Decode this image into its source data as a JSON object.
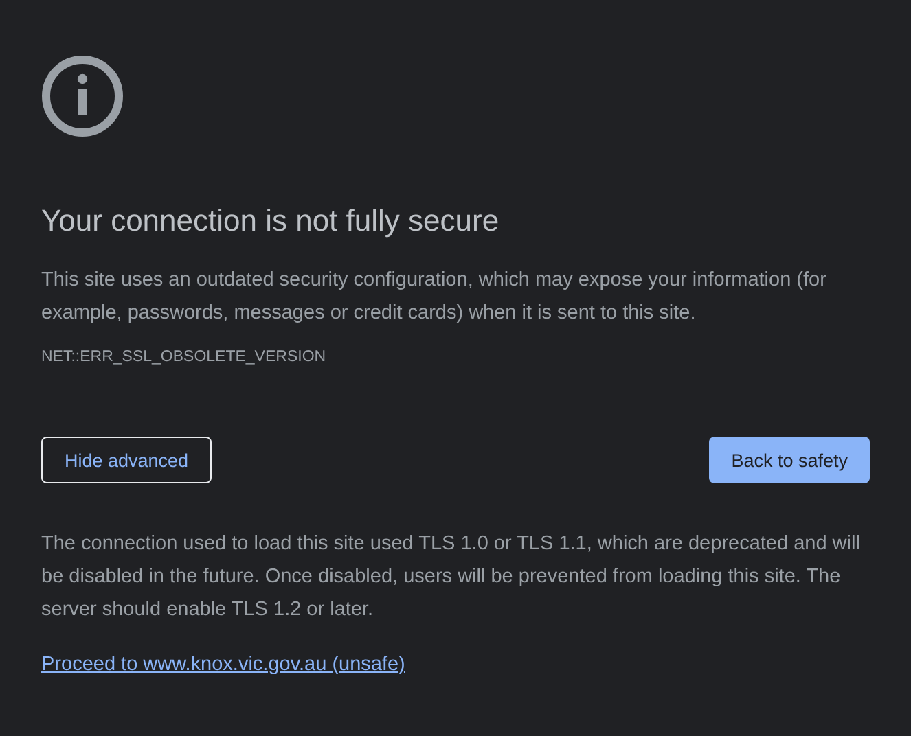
{
  "heading": "Your connection is not fully secure",
  "message": "This site uses an outdated security configuration, which may expose your information (for example, passwords, messages or credit cards) when it is sent to this site.",
  "error_code": "NET::ERR_SSL_OBSOLETE_VERSION",
  "buttons": [
    {
      "label": "Hide advanced",
      "kind": "secondary"
    },
    {
      "label": "Back to safety",
      "kind": "primary"
    }
  ],
  "details": "The connection used to load this site used TLS 1.0 or TLS 1.1, which are deprecated and will be disabled in the future. Once disabled, users will be prevented from loading this site. The server should enable TLS 1.2 or later.",
  "proceed_link": "Proceed to www.knox.vic.gov.au (unsafe)"
}
